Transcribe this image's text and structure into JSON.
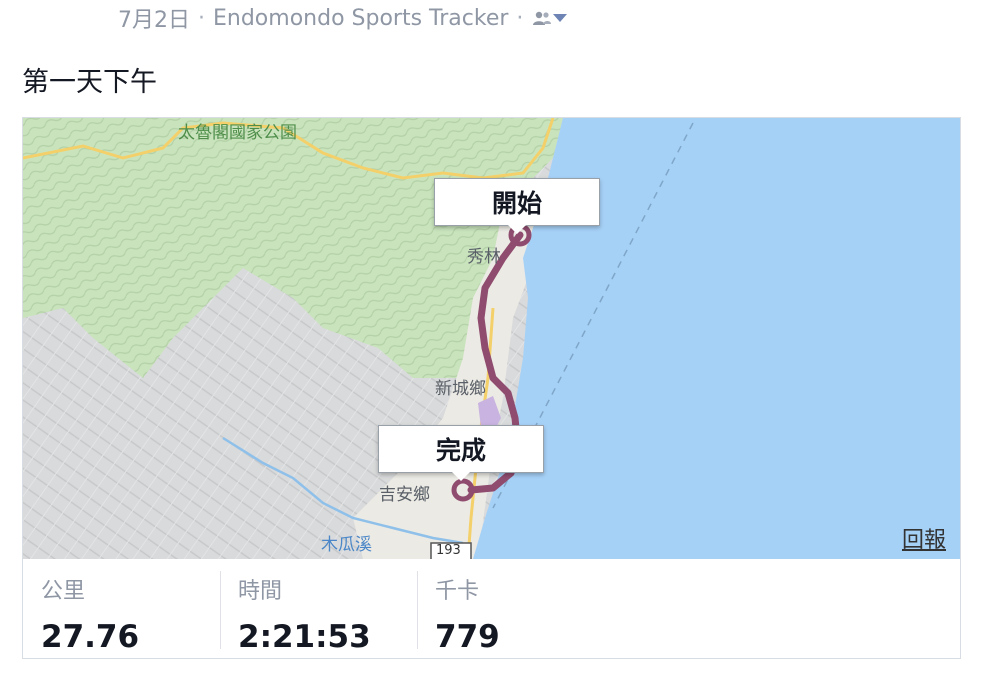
{
  "post": {
    "date": "7月2日",
    "separator": "·",
    "app_name": "Endomondo Sports Tracker",
    "title": "第一天下午"
  },
  "map": {
    "park_label": "太魯閣國家公園",
    "place_xiulin": "秀林",
    "place_xincheng": "新城鄉",
    "place_jian": "吉安鄉",
    "river_label": "木瓜溪",
    "road_number": "193",
    "start_marker": "開始",
    "finish_marker": "完成",
    "report_link": "回報",
    "colors": {
      "sea": "#a6d1f7",
      "forest": "#c9e4bd",
      "terrain": "#d9dadb",
      "route": "#8f4c6f"
    }
  },
  "stats": [
    {
      "label": "公里",
      "value": "27.76"
    },
    {
      "label": "時間",
      "value": "2:21:53"
    },
    {
      "label": "千卡",
      "value": "779"
    }
  ]
}
